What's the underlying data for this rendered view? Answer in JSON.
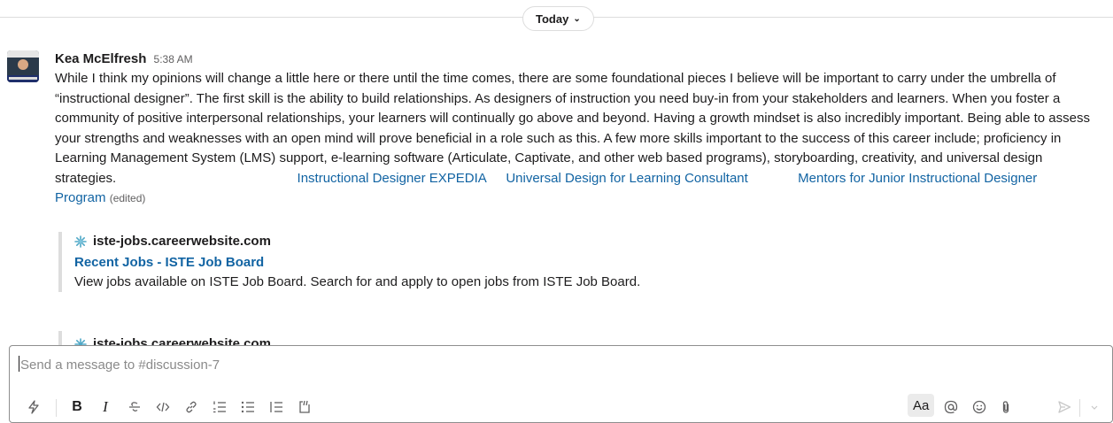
{
  "divider": {
    "date_label": "Today"
  },
  "message": {
    "author": "Kea McElfresh",
    "time": "5:38 AM",
    "text": "While I think my opinions will change a little here or there until the time comes, there are some foundational pieces I believe will be important to carry under the umbrella of “instructional designer”. The first skill is the ability to build relationships. As designers of instruction you need buy-in from your stakeholders and learners. When you foster a community of positive interpersonal relationships, your learners will continually go above and beyond. Having a growth mindset is also incredibly important. Being able to assess your strengths and weaknesses with an open mind will prove beneficial in a role such as this. A few more skills important to the success of this career include; proficiency in Learning Management System (LMS) support, e-learning software (Articulate, Captivate, and other web based programs), storyboarding, creativity, and universal design strategies.",
    "links": [
      "Instructional Designer EXPEDIA",
      "Universal Design for Learning Consultant",
      "Mentors for Junior Instructional Designer Program"
    ],
    "edited_label": "(edited)"
  },
  "attachment": {
    "site": "iste-jobs.careerwebsite.com",
    "title": "Recent Jobs - ISTE Job Board",
    "description": "View jobs available on ISTE Job Board. Search for and apply to open jobs from ISTE Job Board."
  },
  "attachment2": {
    "site": "iste-jobs.careerwebsite.com"
  },
  "composer": {
    "placeholder": "Send a message to #discussion-7",
    "toolbar": {
      "shortcuts_icon": "lightning-icon",
      "bold": "B",
      "italic": "I",
      "formatting_toggle": "Aa"
    }
  },
  "colors": {
    "link": "#1264a3",
    "text": "#1d1c1d",
    "muted": "#616061"
  }
}
